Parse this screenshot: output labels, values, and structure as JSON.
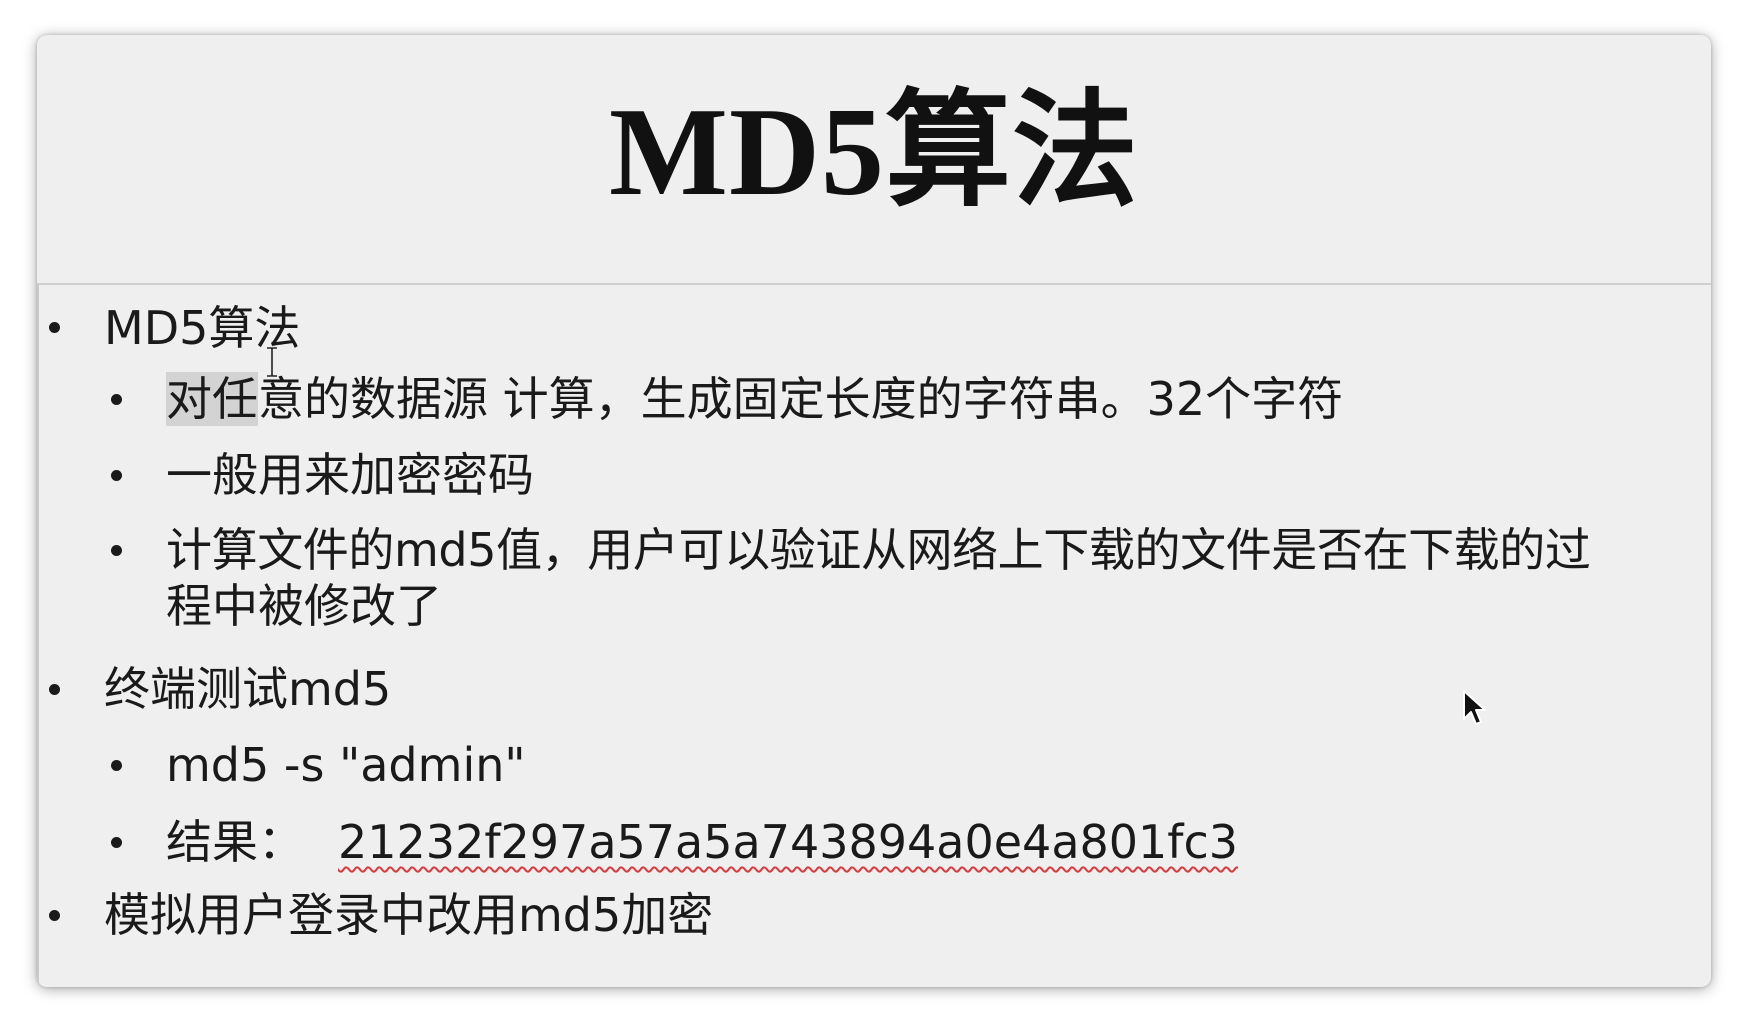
{
  "slide": {
    "title": "MD5算法",
    "items": [
      {
        "level": 1,
        "text": "MD5算法"
      },
      {
        "level": 2,
        "text_highlighted": "对任",
        "text_rest": "意的数据源 计算，生成固定长度的字符串。32个字符"
      },
      {
        "level": 2,
        "text": "一般用来加密密码"
      },
      {
        "level": 2,
        "line1": "计算文件的md5值，用户可以验证从网络上下载的文件是否在下载的过",
        "line2": "程中被修改了"
      },
      {
        "level": 1,
        "text": "终端测试md5"
      },
      {
        "level": 2,
        "text": "md5 -s \"admin\""
      },
      {
        "level": 2,
        "label": "结果：",
        "hash": "21232f297a57a5a743894a0e4a801fc3"
      },
      {
        "level": 1,
        "text": "模拟用户登录中改用md5加密"
      }
    ]
  },
  "icons": {
    "text_cursor": "i-beam-cursor-icon",
    "mouse_pointer": "arrow-pointer-icon"
  },
  "colors": {
    "slide_background": "#efefef",
    "text": "#1a1a1a",
    "highlight": "#d3d3d3",
    "spellcheck_underline": "#d83b3b"
  }
}
